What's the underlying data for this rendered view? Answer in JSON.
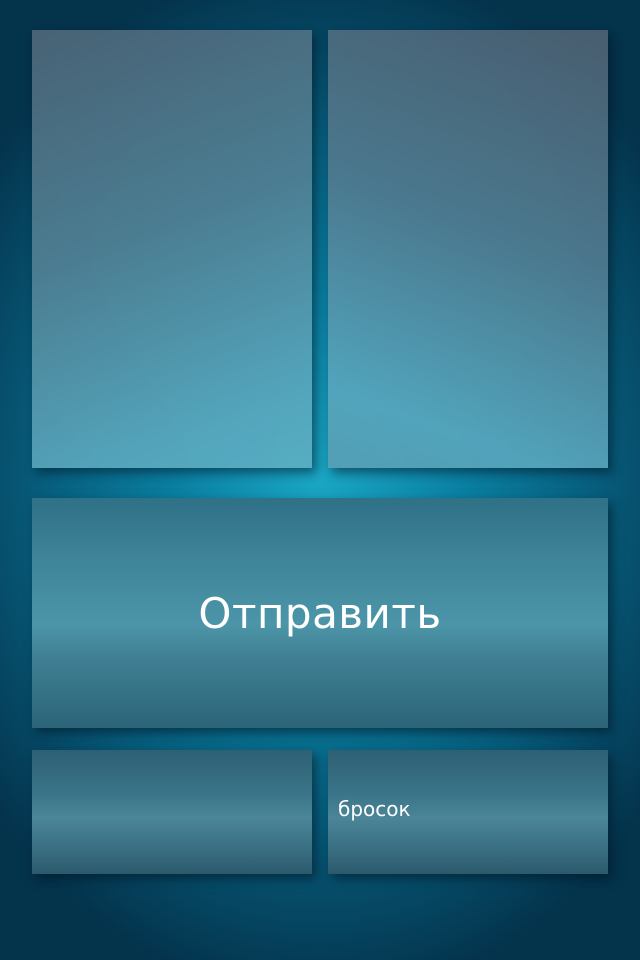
{
  "colors": {
    "background_center": "#1aa6c4",
    "background_edge": "#04334c",
    "tile_text": "#ffffff"
  },
  "buttons": {
    "send_label": "Отправить",
    "throw_label": "бросок"
  }
}
